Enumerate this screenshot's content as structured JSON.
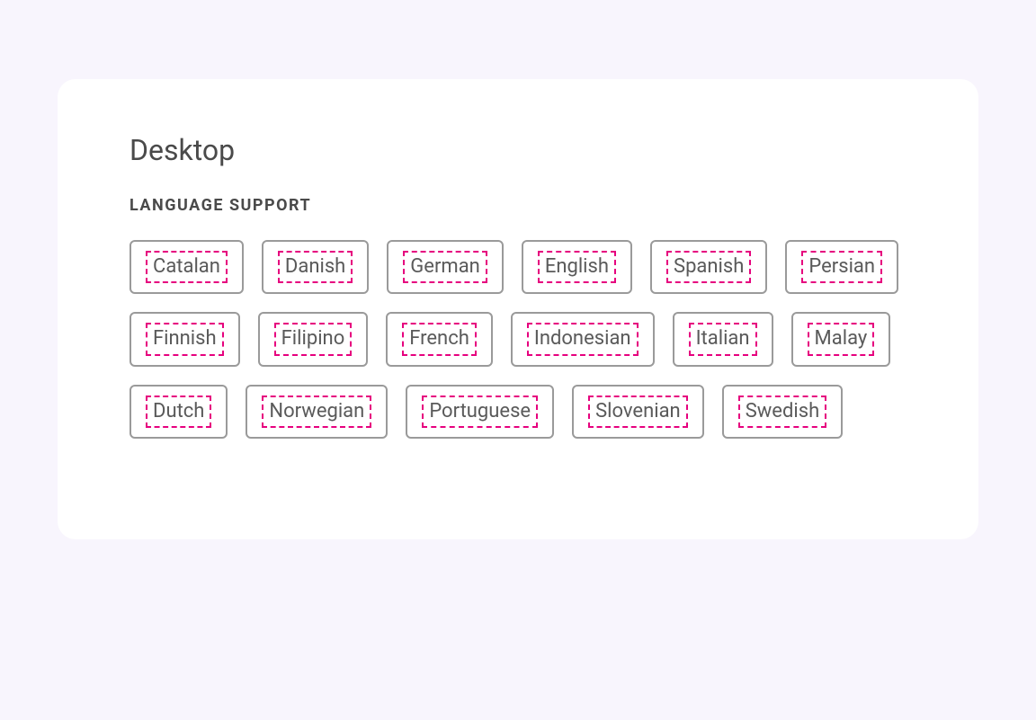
{
  "card": {
    "title": "Desktop",
    "section_label": "LANGUAGE SUPPORT",
    "languages": [
      "Catalan",
      "Danish",
      "German",
      "English",
      "Spanish",
      "Persian",
      "Finnish",
      "Filipino",
      "French",
      "Indonesian",
      "Italian",
      "Malay",
      "Dutch",
      "Norwegian",
      "Portuguese",
      "Slovenian",
      "Swedish"
    ]
  }
}
